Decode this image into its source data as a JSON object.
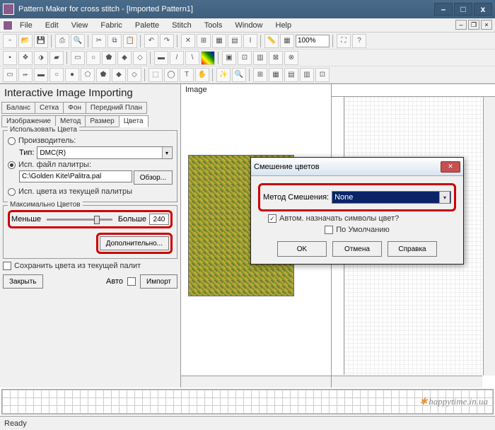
{
  "window": {
    "title": "Pattern Maker for cross stitch - [Imported Pattern1]"
  },
  "menu": {
    "file": "File",
    "edit": "Edit",
    "view": "View",
    "fabric": "Fabric",
    "palette": "Palette",
    "stitch": "Stitch",
    "tools": "Tools",
    "window": "Window",
    "help": "Help"
  },
  "zoom": "100%",
  "panel": {
    "title": "Interactive Image Importing",
    "tabs": {
      "balance": "Баланс",
      "grid": "Сетка",
      "bg": "Фон",
      "fg": "Передний План",
      "img": "Изображение",
      "method": "Метод",
      "size": "Размер",
      "colors": "Цвета"
    },
    "use_colors": "Использовать Цвета",
    "manufacturer": "Производитель:",
    "type_label": "Тип:",
    "type_value": "DMC(R)",
    "use_palette": "Исп. файл палитры:",
    "palette_path": "C:\\Golden Kite\\Palitra.pal",
    "browse": "Обзор...",
    "use_current": "Исп. цвета из текущей палитры",
    "max_colors": "Максимально Цветов",
    "less": "Меньше",
    "more": "Больше",
    "max_value": "240",
    "advanced": "Дополнительно...",
    "save_colors": "Сохранить цвета из текущей палит",
    "close": "Закрыть",
    "auto": "Авто",
    "import": "Импорт"
  },
  "center": {
    "label": "Image"
  },
  "dialog": {
    "title": "Смешение цветов",
    "method_label": "Метод Смешения:",
    "method_value": "None",
    "auto_symbols": "Автом. назначать символы цвет?",
    "default": "По Умолчанию",
    "ok": "OK",
    "cancel": "Отмена",
    "help": "Справка"
  },
  "status": "Ready",
  "watermark": "happytime.in.ua"
}
